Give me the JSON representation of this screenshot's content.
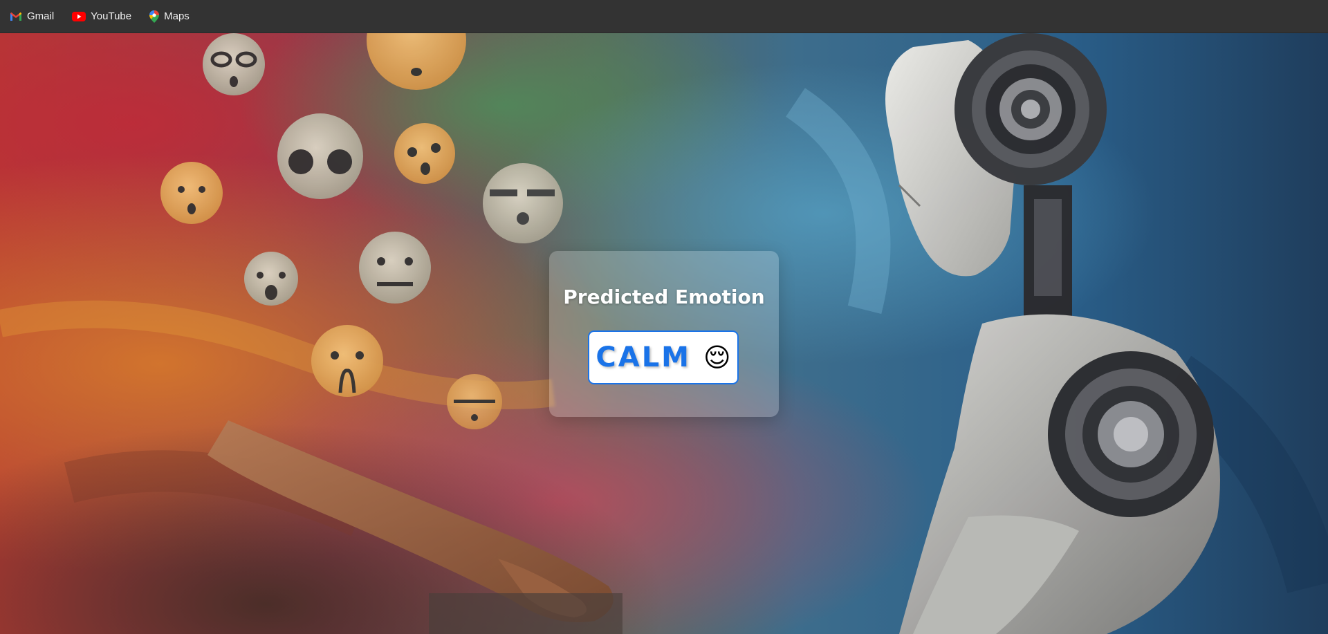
{
  "bookmarks": [
    {
      "label": "Gmail",
      "icon": "gmail-icon"
    },
    {
      "label": "YouTube",
      "icon": "youtube-icon"
    },
    {
      "label": "Maps",
      "icon": "maps-icon"
    }
  ],
  "result": {
    "title": "Predicted Emotion",
    "emotion": "CALM",
    "emoji": "😌"
  },
  "colors": {
    "bookmark_bar": "#333333",
    "accent": "#1a73e8"
  }
}
